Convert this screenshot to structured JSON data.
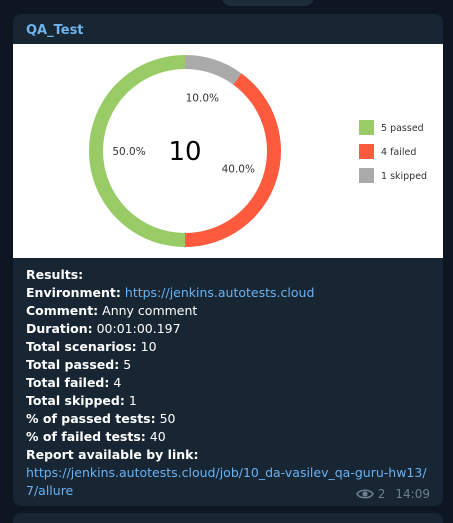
{
  "message": {
    "sender": "QA_Test",
    "views": "2",
    "time": "14:09"
  },
  "chart_data": {
    "type": "pie",
    "center_label": "10",
    "slices": [
      {
        "name": "5 passed",
        "value": 5,
        "percent_label": "50.0%",
        "color": "#99cc66"
      },
      {
        "name": "4 failed",
        "value": 4,
        "percent_label": "40.0%",
        "color": "#fd5a3e"
      },
      {
        "name": "1 skipped",
        "value": 1,
        "percent_label": "10.0%",
        "color": "#aaaaaa"
      }
    ],
    "legend_position": "right"
  },
  "report": {
    "results_label": "Results:",
    "environment_label": "Environment:",
    "environment_value": "https://jenkins.autotests.cloud",
    "comment_label": "Comment:",
    "comment_value": "Anny comment",
    "duration_label": "Duration:",
    "duration_value": "00:01:00.197",
    "total_scenarios_label": "Total scenarios:",
    "total_scenarios_value": "10",
    "total_passed_label": "Total passed:",
    "total_passed_value": "5",
    "total_failed_label": "Total failed:",
    "total_failed_value": "4",
    "total_skipped_label": "Total skipped:",
    "total_skipped_value": "1",
    "pct_passed_label": "% of passed tests:",
    "pct_passed_value": "50",
    "pct_failed_label": "% of failed tests:",
    "pct_failed_value": "40",
    "report_link_label": "Report available by link:",
    "report_link_value": "https://jenkins.autotests.cloud/job/10_da-vasilev_qa-guru-hw13/7/allure"
  }
}
